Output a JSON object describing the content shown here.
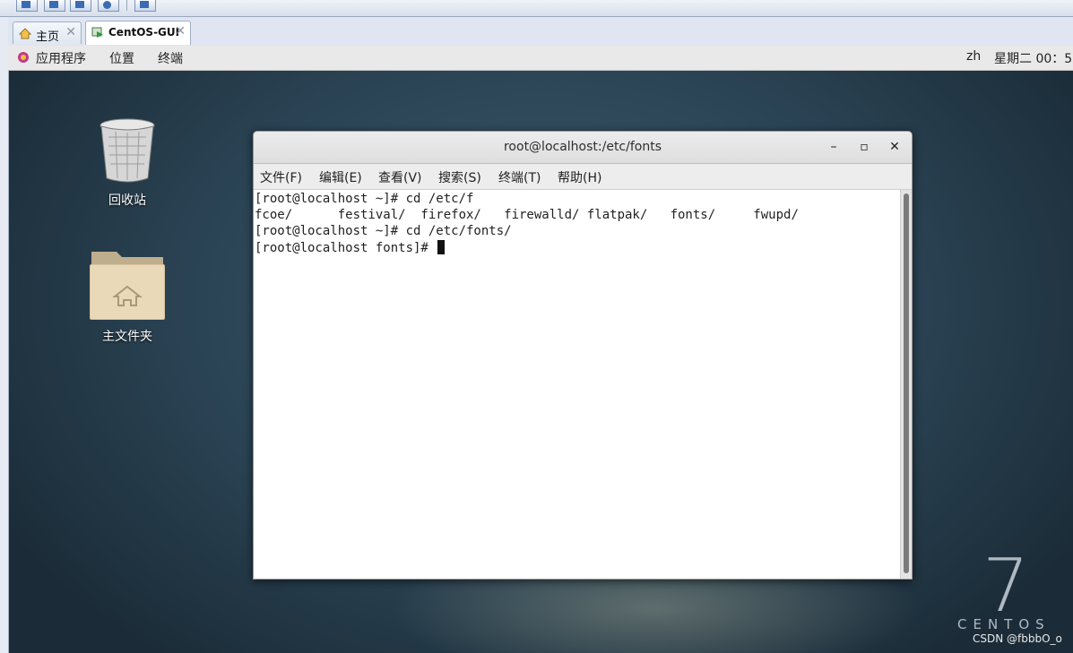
{
  "host_toolbar": {
    "buttons": [
      "toolbar-button-1",
      "toolbar-button-2",
      "toolbar-button-3",
      "toolbar-button-info",
      "toolbar-button-fullscreen"
    ]
  },
  "tabs": [
    {
      "label": "主页",
      "icon": "home-icon",
      "close": "✕"
    },
    {
      "label": "CentOS-GUI",
      "icon": "vm-play-icon",
      "close": "✕",
      "active": true
    }
  ],
  "gnome_bar": {
    "applications": "应用程序",
    "places": "位置",
    "terminal": "终端",
    "lang": "zh",
    "clock": "星期二 00：5"
  },
  "desktop": {
    "trash_label": "回收站",
    "home_label": "主文件夹",
    "branding_number": "7",
    "branding_word": "CENTOS",
    "watermark": "CSDN @fbbbO_o"
  },
  "terminal": {
    "title": "root@localhost:/etc/fonts",
    "controls": {
      "minimize": "–",
      "maximize": "▫",
      "close": "✕"
    },
    "menu": [
      "文件(F)",
      "编辑(E)",
      "查看(V)",
      "搜索(S)",
      "终端(T)",
      "帮助(H)"
    ],
    "lines": [
      "[root@localhost ~]# cd /etc/f",
      "fcoe/      festival/  firefox/   firewalld/ flatpak/   fonts/     fwupd/",
      "[root@localhost ~]# cd /etc/fonts/",
      "[root@localhost fonts]# "
    ]
  },
  "colors": {
    "desktop_bg": "#2b4455",
    "terminal_bg": "#ffffff",
    "titlebar": "#e4e4e4"
  }
}
